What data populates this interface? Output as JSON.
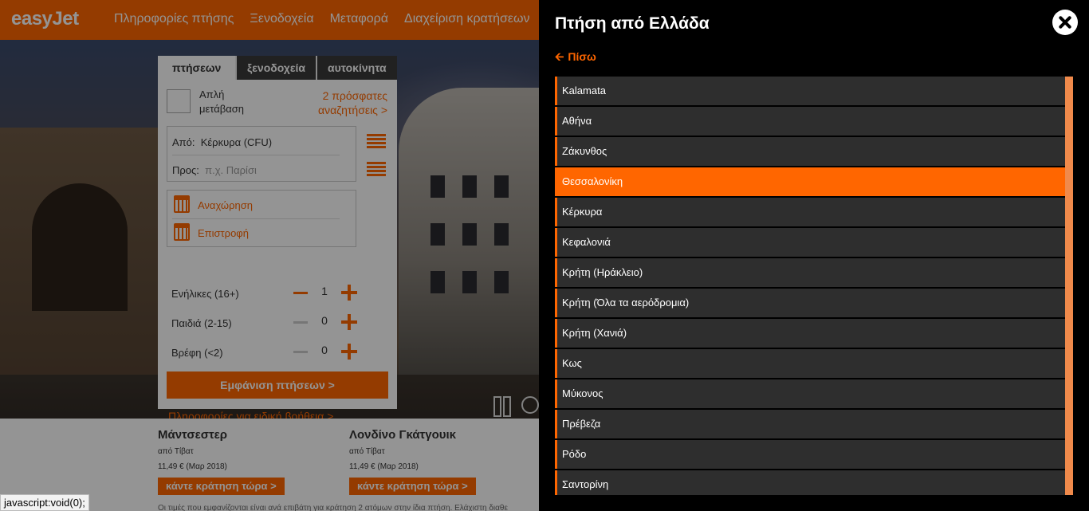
{
  "header": {
    "logo": "easyJet",
    "nav": [
      "Πληροφορίες πτήσης",
      "Ξενοδοχεία",
      "Μεταφορά",
      "Διαχείριση κρατήσεων"
    ]
  },
  "search_widget": {
    "tabs": [
      "πτήσεων",
      "ξενοδοχεία",
      "αυτοκίνητα"
    ],
    "one_way_label": "Απλή μετάβαση",
    "recent_searches": "2 πρόσφατες αναζητήσεις >",
    "from_label": "Από:",
    "from_value": "Κέρκυρα (CFU)",
    "to_label": "Προς:",
    "to_placeholder": "π.χ. Παρίσι",
    "departure_label": "Αναχώρηση",
    "return_label": "Επιστροφή",
    "adults_label": "Ενήλικες (16+)",
    "adults_count": "1",
    "children_label": "Παιδιά (2-15)",
    "children_count": "0",
    "infants_label": "Βρέφη (<2)",
    "infants_count": "0",
    "show_flights_button": "Εμφάνιση πτήσεων >",
    "special_assistance_link": "Πληροφορίες για ειδική βοήθεια >"
  },
  "deals": [
    {
      "city": "Μάντσεστερ",
      "from": "από Τίβατ",
      "price": "11,49 €",
      "date": "(Μαρ 2018)",
      "button": "κάντε κράτηση τώρα >"
    },
    {
      "city": "Λονδίνο Γκάτγουικ",
      "from": "από Τίβατ",
      "price": "11,49 €",
      "date": "(Μαρ 2018)",
      "button": "κάντε κράτηση τώρα >"
    }
  ],
  "fine_print": "Οι τιμές που εμφανίζονται είναι ανά επιβάτη για κράτηση 2 ατόμων στην ίδια πτήση. Ελάχιστη διαθε",
  "status_bar": "javascript:void(0);",
  "panel": {
    "title": "Πτήση από Ελλάδα",
    "back_label": "Πίσω",
    "selected_index": 3,
    "airports": [
      "Kalamata",
      "Αθήνα",
      "Ζάκυνθος",
      "Θεσσαλονίκη",
      "Κέρκυρα",
      "Κεφαλονιά",
      "Κρήτη (Ηράκλειο)",
      "Κρήτη (Όλα τα αερόδρομια)",
      "Κρήτη (Χανιά)",
      "Κως",
      "Μύκονος",
      "Πρέβεζα",
      "Ρόδο",
      "Σαντορίνη"
    ]
  },
  "colors": {
    "accent": "#ff6600",
    "panel_bg": "#000000",
    "item_bg": "#2e2e2e"
  }
}
